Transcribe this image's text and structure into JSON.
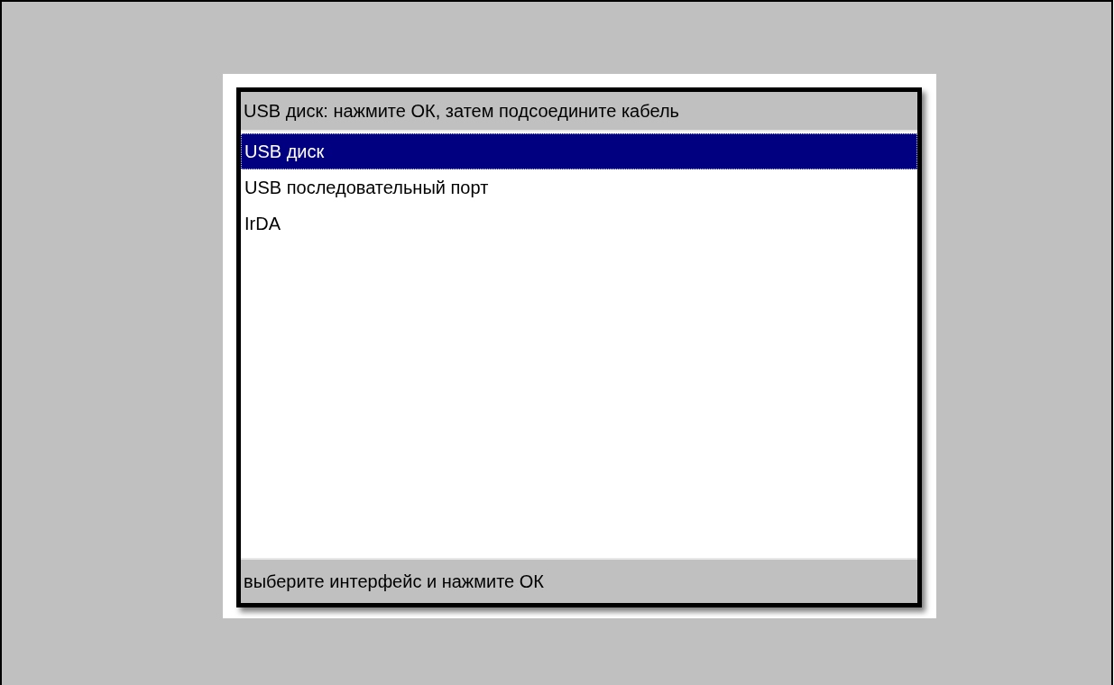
{
  "header": {
    "title": "USB диск: нажмите ОК, затем подсоедините кабель"
  },
  "items": [
    {
      "label": "USB диск",
      "selected": true
    },
    {
      "label": "USB последовательный порт",
      "selected": false
    },
    {
      "label": "IrDA",
      "selected": false
    }
  ],
  "status_bar": {
    "text": "выберите интерфейс и нажмите ОК"
  }
}
